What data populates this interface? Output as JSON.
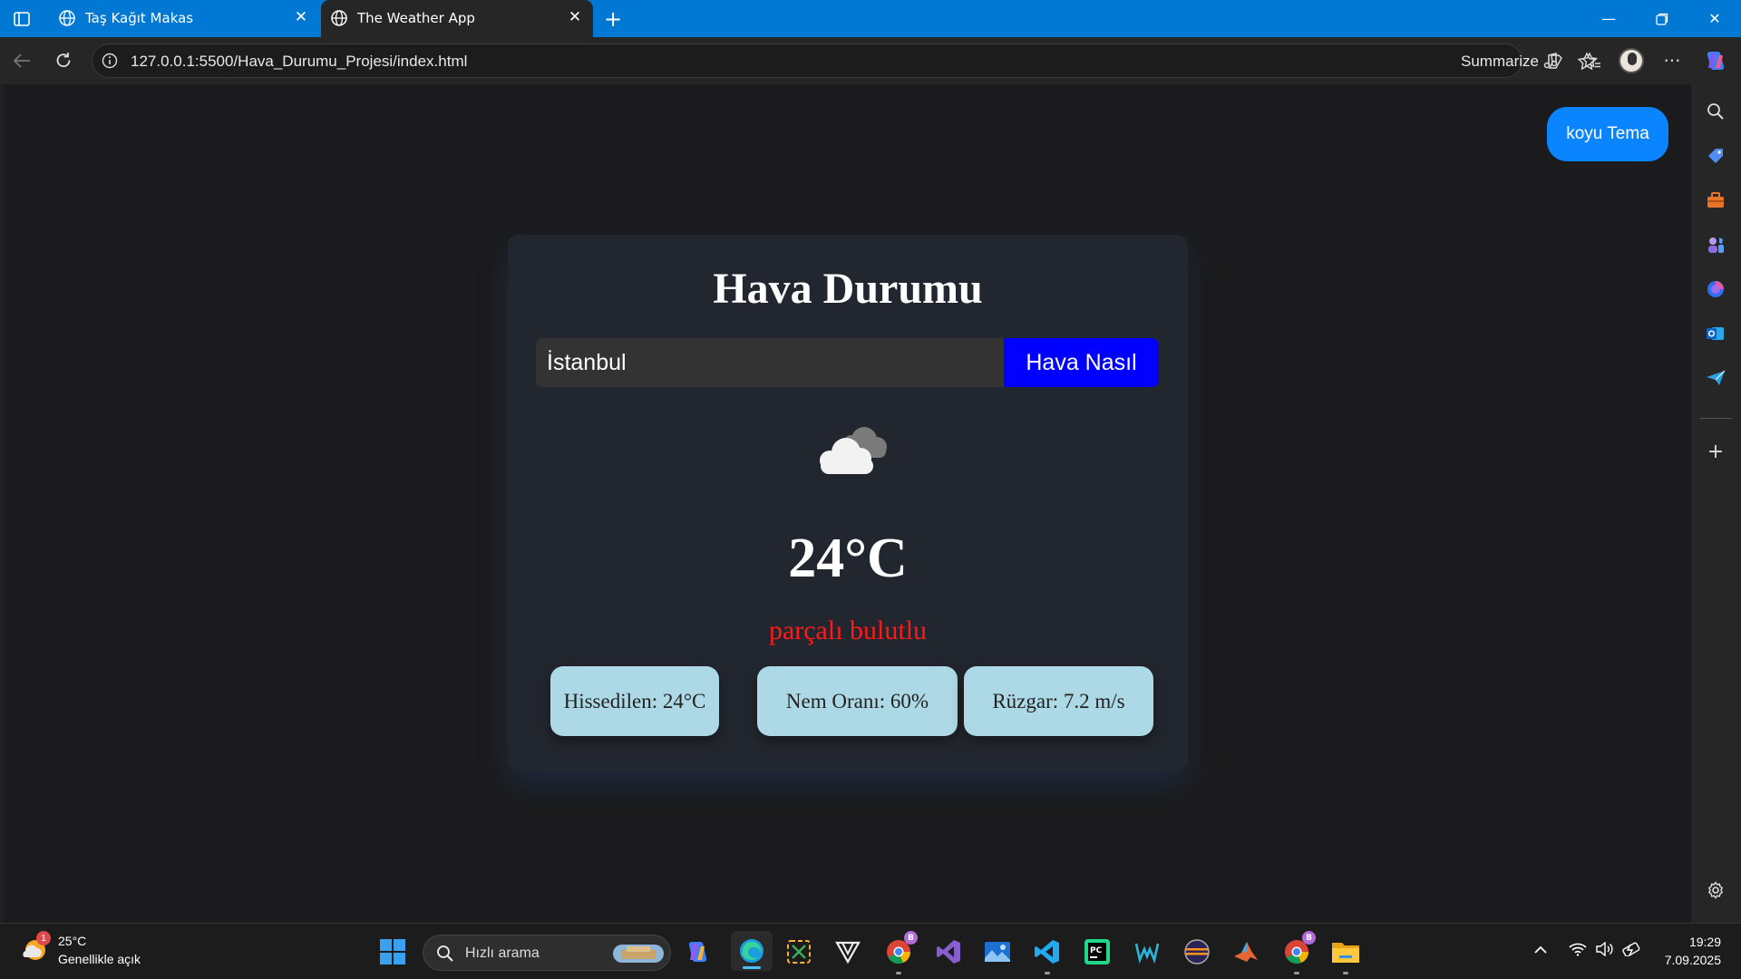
{
  "browser": {
    "tabs": [
      {
        "title": "Taş Kağıt Makas",
        "active": false
      },
      {
        "title": "The Weather App",
        "active": true
      }
    ],
    "url": "127.0.0.1:5500/Hava_Durumu_Projesi/index.html",
    "summarize_label": "Summarize"
  },
  "page": {
    "theme_button": "koyu Tema",
    "title": "Hava Durumu",
    "search": {
      "value": "İstanbul",
      "button": "Hava Nasıl"
    },
    "weather": {
      "icon": "cloud-icon",
      "temperature": "24°C",
      "description": "parçalı bulutlu",
      "details": [
        "Hissedilen: 24°C",
        "Nem Oranı: 60%",
        "Rüzgar: 7.2 m/s"
      ]
    },
    "colors": {
      "accent_button": "#0000ff",
      "theme_button": "#0a84ff",
      "description": "#ff1a1a",
      "detail_card": "#add8e6"
    }
  },
  "taskbar": {
    "weather_badge": "1",
    "weather_temp": "25°C",
    "weather_condition": "Genellikle açık",
    "search_placeholder": "Hızlı arama",
    "time": "19:29",
    "date": "7.09.2025"
  }
}
